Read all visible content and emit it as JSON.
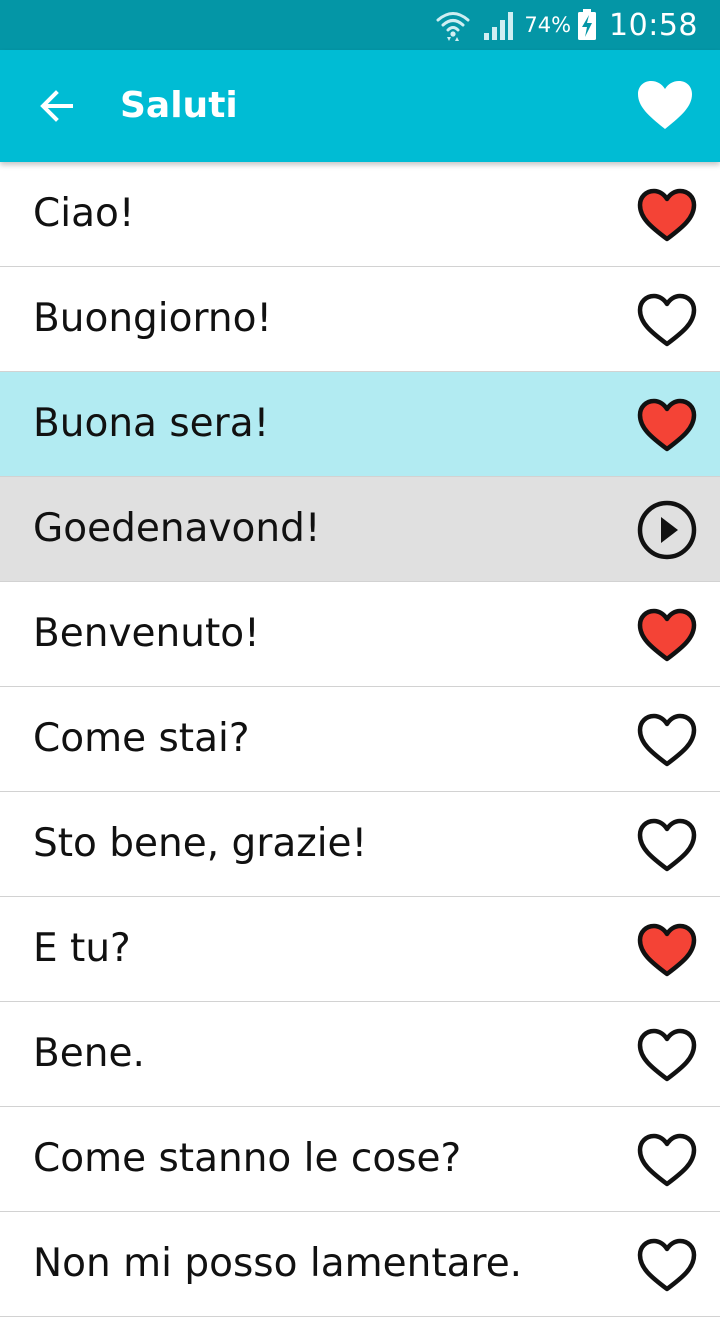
{
  "status_bar": {
    "battery_percent": "74%",
    "time": "10:58",
    "icons": [
      "wifi-icon",
      "signal-icon",
      "battery-charging-icon"
    ]
  },
  "app_bar": {
    "title": "Saluti",
    "back_icon": "arrow-back-icon",
    "favorite_icon": "heart-filled-icon"
  },
  "colors": {
    "status_bar": "#0496a6",
    "app_bar": "#00bcd4",
    "highlight_row": "#b2ebf2",
    "native_row": "#e0e0e0",
    "heart_favorite": "#f44336"
  },
  "phrases": [
    {
      "text": "Ciao!",
      "icon": "heart-icon",
      "favorite": true,
      "state": "normal"
    },
    {
      "text": "Buongiorno!",
      "icon": "heart-icon",
      "favorite": false,
      "state": "normal"
    },
    {
      "text": "Buona sera!",
      "icon": "heart-icon",
      "favorite": true,
      "state": "highlight"
    },
    {
      "text": "Goedenavond!",
      "icon": "play-icon",
      "favorite": false,
      "state": "native"
    },
    {
      "text": "Benvenuto!",
      "icon": "heart-icon",
      "favorite": true,
      "state": "normal"
    },
    {
      "text": "Come stai?",
      "icon": "heart-icon",
      "favorite": false,
      "state": "normal"
    },
    {
      "text": "Sto bene, grazie!",
      "icon": "heart-icon",
      "favorite": false,
      "state": "normal"
    },
    {
      "text": "E tu?",
      "icon": "heart-icon",
      "favorite": true,
      "state": "normal"
    },
    {
      "text": "Bene.",
      "icon": "heart-icon",
      "favorite": false,
      "state": "normal"
    },
    {
      "text": "Come stanno le cose?",
      "icon": "heart-icon",
      "favorite": false,
      "state": "normal"
    },
    {
      "text": "Non mi posso lamentare.",
      "icon": "heart-icon",
      "favorite": false,
      "state": "normal"
    }
  ]
}
